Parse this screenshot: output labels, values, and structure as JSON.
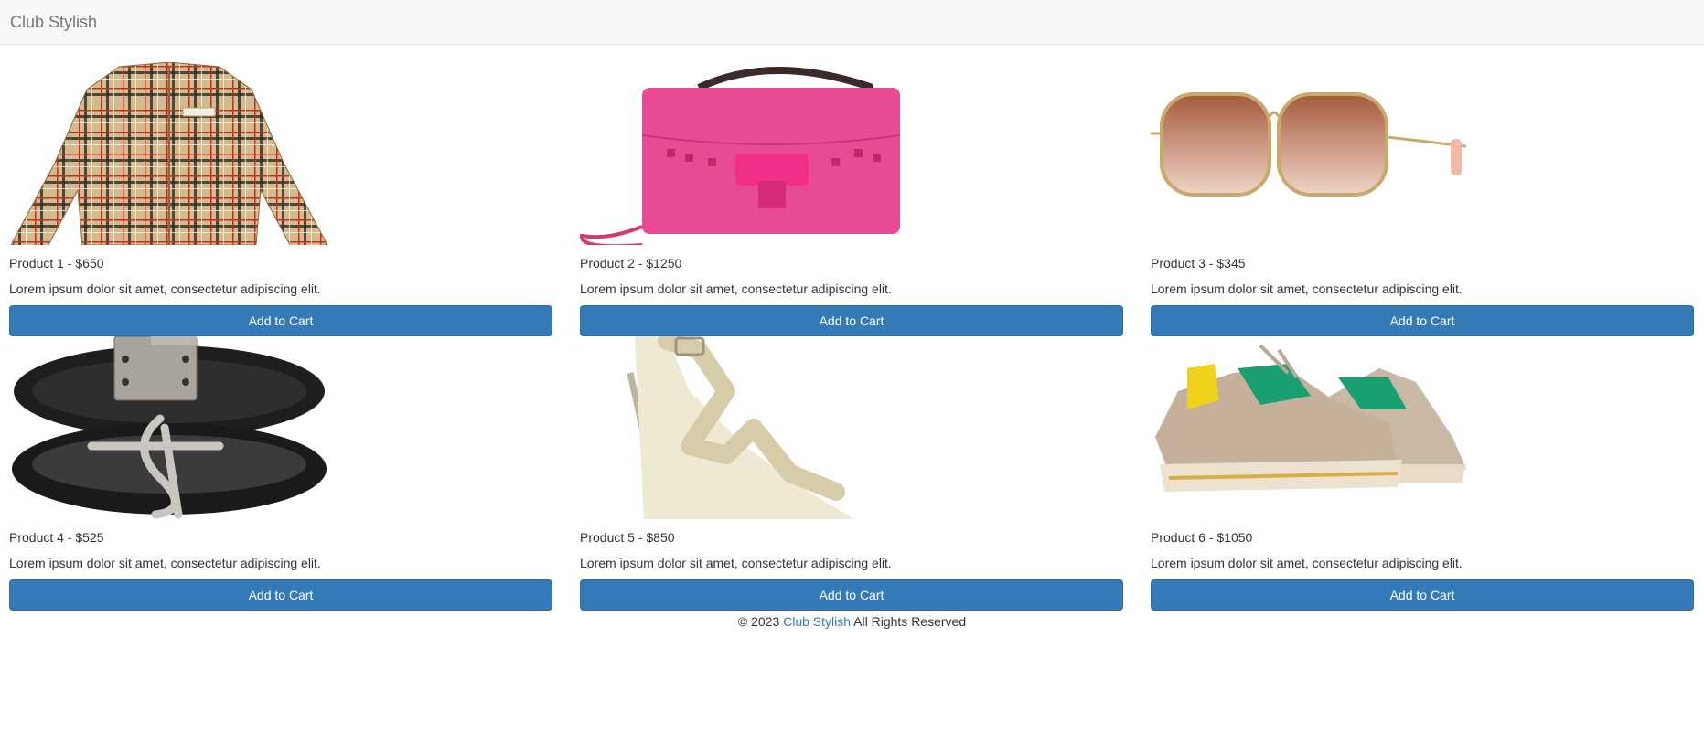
{
  "navbar": {
    "brand": "Club Stylish"
  },
  "products": [
    {
      "title": "Product 1 - $650",
      "description": "Lorem ipsum dolor sit amet, consectetur adipiscing elit.",
      "button": "Add to Cart",
      "image": "plaid-jacket-image"
    },
    {
      "title": "Product 2 - $1250",
      "description": "Lorem ipsum dolor sit amet, consectetur adipiscing elit.",
      "button": "Add to Cart",
      "image": "pink-studded-handbag-image"
    },
    {
      "title": "Product 3 - $345",
      "description": "Lorem ipsum dolor sit amet, consectetur adipiscing elit.",
      "button": "Add to Cart",
      "image": "gold-sunglasses-image"
    },
    {
      "title": "Product 4 - $525",
      "description": "Lorem ipsum dolor sit amet, consectetur adipiscing elit.",
      "button": "Add to Cart",
      "image": "leather-bracelet-image"
    },
    {
      "title": "Product 5 - $850",
      "description": "Lorem ipsum dolor sit amet, consectetur adipiscing elit.",
      "button": "Add to Cart",
      "image": "silver-heel-sandal-image"
    },
    {
      "title": "Product 6 - $1050",
      "description": "Lorem ipsum dolor sit amet, consectetur adipiscing elit.",
      "button": "Add to Cart",
      "image": "chunky-sneakers-image"
    }
  ],
  "footer": {
    "prefix": "© 2023",
    "link": "Club Stylish",
    "suffix": "All Rights Reserved"
  },
  "colors": {
    "primary": "#337ab7",
    "navbar_bg": "#f8f8f8",
    "brand_text": "#777777",
    "body_text": "#333333"
  }
}
